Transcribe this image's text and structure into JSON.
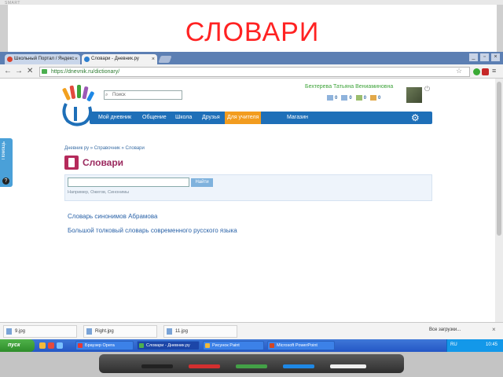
{
  "board": {
    "brand": "SMART"
  },
  "slide": {
    "title": "СЛОВАРИ"
  },
  "browser": {
    "tabs": [
      {
        "label": "Школьный Портал / Яндекс",
        "close": "×"
      },
      {
        "label": "Словари - Дневник.ру",
        "close": "×"
      }
    ],
    "url": "https://dnevnik.ru/dictionary/",
    "window_buttons": [
      "_",
      "▫",
      "×"
    ]
  },
  "site": {
    "search_placeholder": "Поиск",
    "user_name": "Бехтерева Татьяна Вениаминовна",
    "counters": [
      "0",
      "0",
      "0",
      "0"
    ],
    "nav": [
      {
        "label": "Мой дневник"
      },
      {
        "label": "Общение"
      },
      {
        "label": "Школа"
      },
      {
        "label": "Друзья"
      },
      {
        "label": "Для учителя"
      },
      {
        "label": "Магазин"
      }
    ],
    "help_label": "Помощь",
    "help_mark": "?",
    "breadcrumb": "Дневник ру » Справочник » Словари",
    "page_title": "Словари",
    "find_button": "Найти",
    "hint": "Например, Ожегов, Синонимы",
    "dictionaries": [
      "Словарь синонимов Абрамова",
      "Большой толковый словарь современного русского языка"
    ]
  },
  "downloads": {
    "items": [
      "9.jpg",
      "Right.jpg",
      "11.jpg"
    ],
    "show_all": "Все загрузки...",
    "close": "×"
  },
  "taskbar": {
    "start": "пуск",
    "tasks": [
      "Браузер Opera",
      "Словари - Дневник.ру",
      "Рисунок Paint",
      "Microsoft PowerPoint"
    ],
    "lang": "RU",
    "clock": "10:45"
  },
  "colors": {
    "slide_title": "#ff2222",
    "nav_bg": "#1e6fb8",
    "nav_active": "#f29c1f",
    "user_name": "#3ea33a",
    "page_title": "#9b2a5f",
    "link": "#2b63a8"
  }
}
